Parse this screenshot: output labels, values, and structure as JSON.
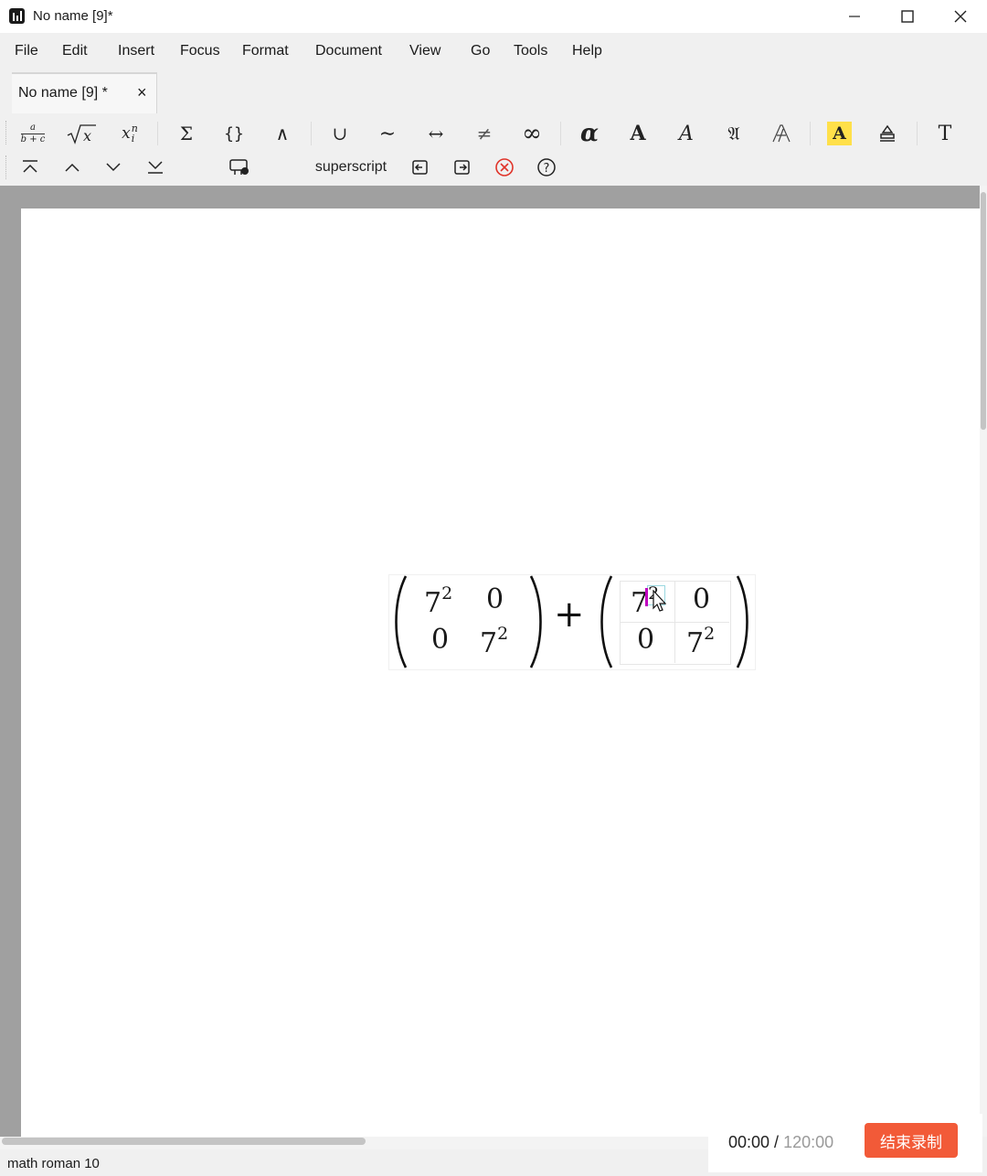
{
  "window": {
    "title": "No name [9]*",
    "minimize_glyph": "─",
    "maximize_glyph": "☐",
    "close_glyph": "✕"
  },
  "menu": [
    "File",
    "Edit",
    "Insert",
    "Focus",
    "Format",
    "Document",
    "View",
    "Go",
    "Tools",
    "Help"
  ],
  "tab": {
    "label": "No name [9] *",
    "close_glyph": "×"
  },
  "toolbar1": {
    "icons": [
      "fraction-icon",
      "sqrt-icon",
      "subscript-superscript-icon",
      "sum-icon",
      "braces-icon",
      "wedge-icon",
      "union-icon",
      "tilde-icon",
      "left-right-arrow-icon",
      "not-equal-icon",
      "infinity-icon",
      "alpha-icon",
      "bold-icon",
      "italic-script-icon",
      "fraktur-icon",
      "double-struck-icon",
      "highlight-icon",
      "eraser-icon",
      "text-mode-icon"
    ],
    "fraction_num": "a",
    "fraction_den": "b + c",
    "sqrt_var": "x",
    "sub_var": "x",
    "sub_sup": "n",
    "sub_sub": "i",
    "sum": "Σ",
    "braces": "{}",
    "wedge": "∧",
    "union": "∪",
    "tilde": "∼",
    "arrow": "↔",
    "neq": "≠",
    "infinity": "∞",
    "alpha": "α",
    "bold": "A",
    "italic": "A",
    "fraktur": "𝔄",
    "doublestruck": "𝔸",
    "highlight": "A",
    "text": "T",
    "accent_highlight": "#ffe04a"
  },
  "toolbar2": {
    "icons": [
      "move-to-top-icon",
      "move-up-icon",
      "move-down-icon",
      "move-to-bottom-icon",
      "insert-template-icon",
      "exit-left-icon",
      "exit-right-icon",
      "cancel-icon",
      "help-icon"
    ],
    "mode_label": "superscript",
    "cancel_color": "#e0342a"
  },
  "equation": {
    "plus": "+",
    "matrix1": [
      [
        "7",
        "2",
        "0",
        ""
      ],
      [
        "0",
        "",
        "7",
        "2"
      ]
    ],
    "matrix2": [
      [
        "7",
        "2",
        "0",
        ""
      ],
      [
        "0",
        "",
        "7",
        "2"
      ]
    ],
    "cursor_color": "#c000c0"
  },
  "status": {
    "text": "math roman 10"
  },
  "recorder": {
    "elapsed": "00:00",
    "separator": " / ",
    "total": "120:00",
    "stop_label": "结束录制",
    "button_color": "#f25a38"
  }
}
